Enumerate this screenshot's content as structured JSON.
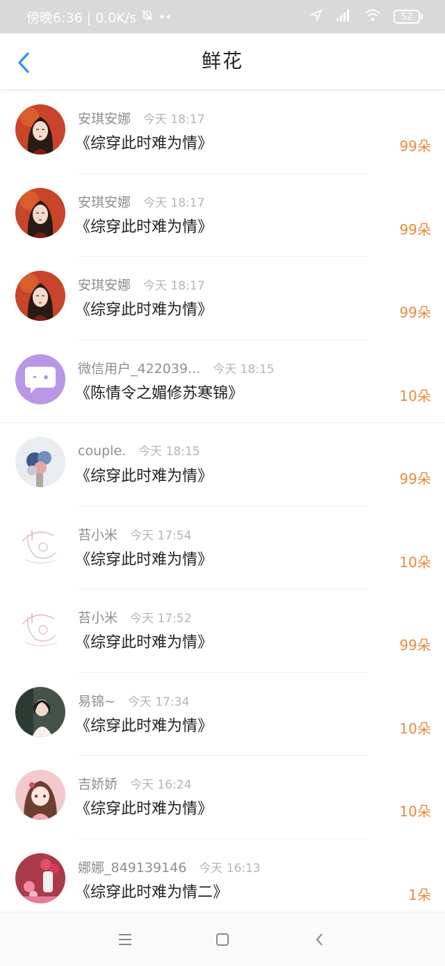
{
  "status_bar": {
    "left_text": "傍晚6:36 | 0.0K/s",
    "battery": "52"
  },
  "header": {
    "title": "鲜花"
  },
  "rows": [
    {
      "user": "安琪安娜",
      "time": "今天 18:17",
      "book": "《综穿此时难为情》",
      "count": "99朵",
      "avatar": "red-portrait"
    },
    {
      "user": "安琪安娜",
      "time": "今天 18:17",
      "book": "《综穿此时难为情》",
      "count": "99朵",
      "avatar": "red-portrait"
    },
    {
      "user": "安琪安娜",
      "time": "今天 18:17",
      "book": "《综穿此时难为情》",
      "count": "99朵",
      "avatar": "red-portrait"
    },
    {
      "user": "微信用户_422039...",
      "time": "今天 18:15",
      "book": "《陈情令之媚修苏寒锦》",
      "count": "10朵",
      "avatar": "chat-bubble"
    },
    {
      "user": "couple.",
      "time": "今天 18:15",
      "book": "《综穿此时难为情》",
      "count": "99朵",
      "avatar": "flowers"
    },
    {
      "user": "苔小米",
      "time": "今天 17:54",
      "book": "《综穿此时难为情》",
      "count": "10朵",
      "avatar": "sketch"
    },
    {
      "user": "苔小米",
      "time": "今天 17:52",
      "book": "《综穿此时难为情》",
      "count": "99朵",
      "avatar": "sketch"
    },
    {
      "user": "易锦~",
      "time": "今天 17:34",
      "book": "《综穿此时难为情》",
      "count": "10朵",
      "avatar": "photo-girl"
    },
    {
      "user": "吉娇娇",
      "time": "今天 16:24",
      "book": "《综穿此时难为情》",
      "count": "10朵",
      "avatar": "anime-girl"
    },
    {
      "user": "娜娜_849139146",
      "time": "今天 16:13",
      "book": "《综穿此时难为情二》",
      "count": "1朵",
      "avatar": "pink-roses"
    }
  ],
  "colors": {
    "accent": "#2e8ff0",
    "count": "#e98b3c"
  }
}
